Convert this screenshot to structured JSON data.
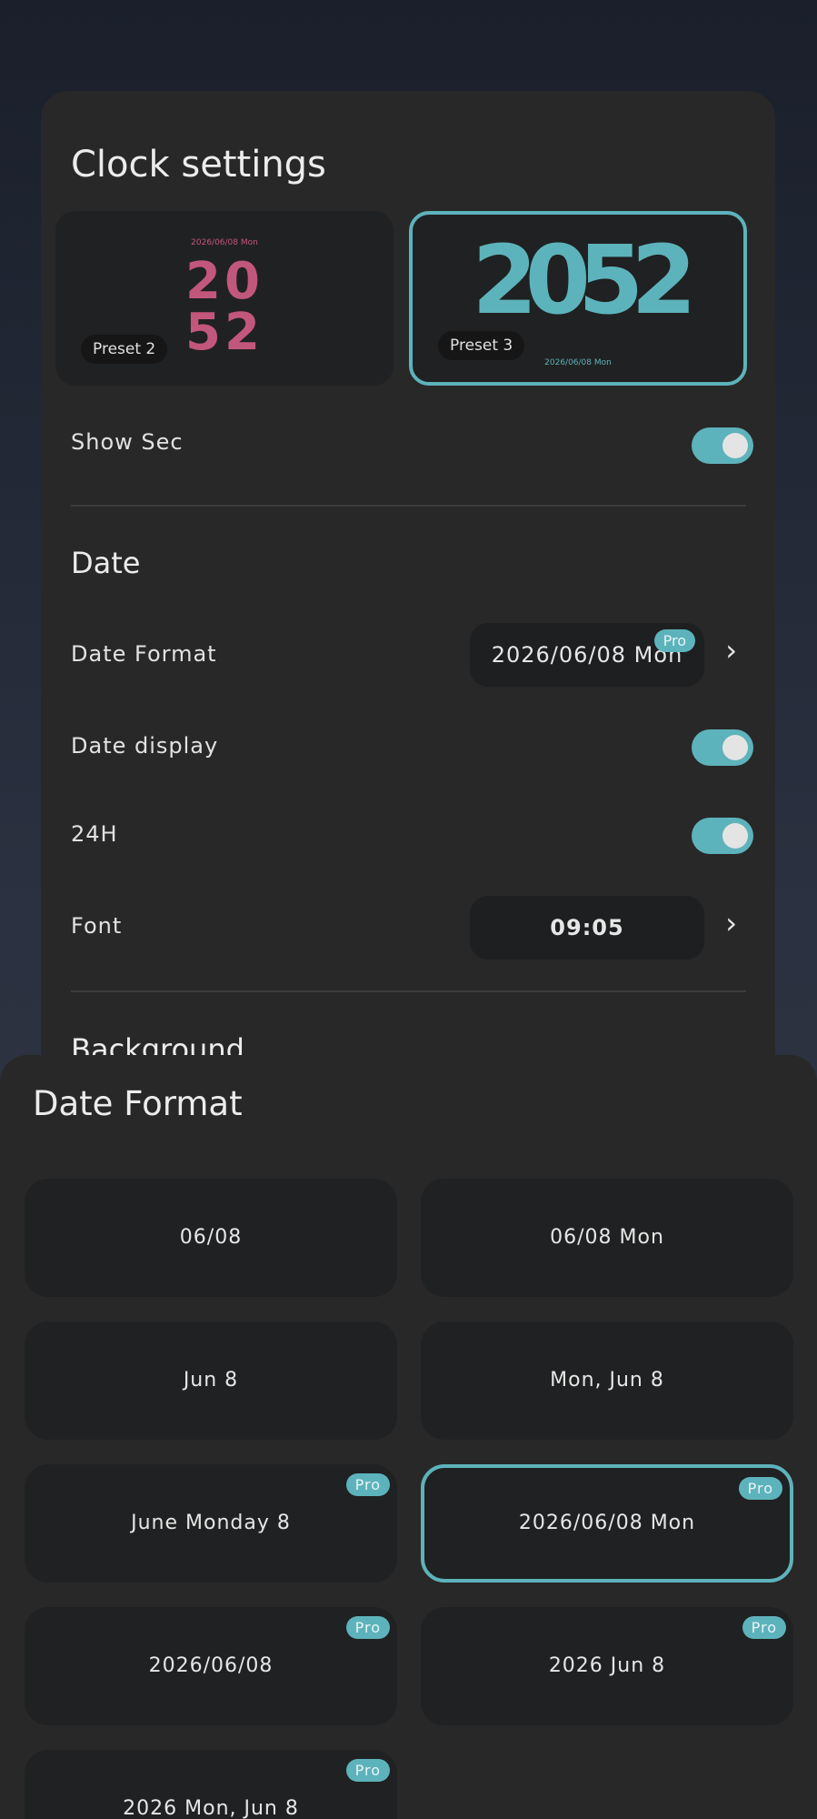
{
  "settings": {
    "title": "Clock settings",
    "presets": [
      {
        "label": "Preset 2",
        "date": "2026/06/08 Mon",
        "hours": "20",
        "minutes": "52"
      },
      {
        "label": "Preset 3",
        "date": "2026/06/08 Mon",
        "time": "2052"
      }
    ],
    "show_sec_label": "Show Sec",
    "date_section": "Date",
    "date_format_label": "Date Format",
    "date_format_value": "2026/06/08 Mon",
    "date_display_label": "Date display",
    "h24_label": "24H",
    "font_label": "Font",
    "font_value": "09:05",
    "background_section": "Background",
    "pro": "Pro",
    "chevron": "›"
  },
  "sheet": {
    "title": "Date Format",
    "options": [
      {
        "label": "06/08",
        "pro": ""
      },
      {
        "label": "06/08 Mon",
        "pro": ""
      },
      {
        "label": "Jun 8",
        "pro": ""
      },
      {
        "label": "Mon, Jun 8",
        "pro": ""
      },
      {
        "label": "June Monday 8",
        "pro": "Pro"
      },
      {
        "label": "2026/06/08 Mon",
        "pro": "Pro",
        "selected": true
      },
      {
        "label": "2026/06/08",
        "pro": "Pro"
      },
      {
        "label": "2026 Jun 8",
        "pro": "Pro"
      },
      {
        "label": "2026 Mon, Jun 8",
        "pro": "Pro"
      }
    ]
  },
  "colors": {
    "accent": "#5db3bb",
    "preset2": "#c2577c",
    "card": "#282828",
    "tile": "#202122"
  },
  "icons": [
    "chevron-right-icon"
  ]
}
